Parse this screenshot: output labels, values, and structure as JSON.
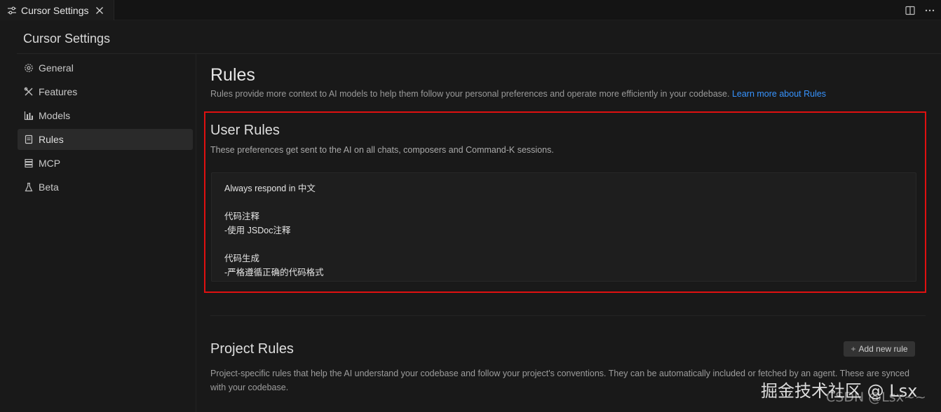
{
  "tab": {
    "title": "Cursor Settings"
  },
  "header": {
    "title": "Cursor Settings"
  },
  "sidebar": {
    "items": [
      {
        "label": "General",
        "icon": "gear-icon"
      },
      {
        "label": "Features",
        "icon": "tools-icon"
      },
      {
        "label": "Models",
        "icon": "bar-chart-icon"
      },
      {
        "label": "Rules",
        "icon": "document-icon",
        "active": true
      },
      {
        "label": "MCP",
        "icon": "server-icon"
      },
      {
        "label": "Beta",
        "icon": "flask-icon"
      }
    ]
  },
  "main": {
    "title": "Rules",
    "description": "Rules provide more context to AI models to help them follow your personal preferences and operate more efficiently in your codebase.",
    "learn_more": "Learn more about Rules",
    "user_rules": {
      "title": "User Rules",
      "description": "These preferences get sent to the AI on all chats, composers and Command-K sessions.",
      "lines": [
        "Always respond in 中文",
        "",
        "代码注释",
        "-使用 JSDoc注释",
        "",
        "代码生成",
        "-严格遵循正确的代码格式"
      ]
    },
    "project_rules": {
      "title": "Project Rules",
      "add_label": "Add new rule",
      "description": "Project-specific rules that help the AI understand your codebase and follow your project's conventions. They can be automatically included or fetched by an agent. These are synced with your codebase."
    }
  },
  "watermark": {
    "main": "掘金技术社区 @ Lsx",
    "sub": "CSDN @Lsx~~"
  },
  "colors": {
    "background": "#191919",
    "highlight": "#e01010",
    "link": "#3794ff"
  }
}
